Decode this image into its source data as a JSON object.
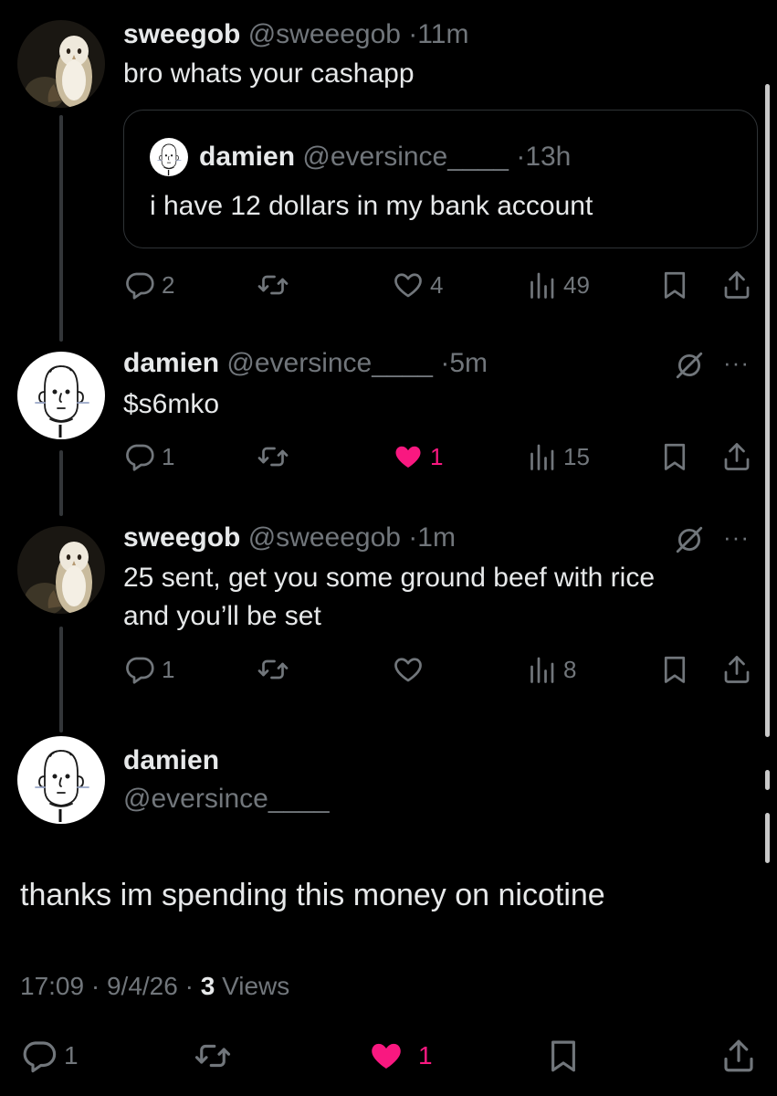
{
  "posts": [
    {
      "name": "sweegob",
      "handle": "@sweeegob",
      "dot": "·",
      "time": "11m",
      "text": "bro whats your cashapp",
      "avatar_icon": "barn-owl-avatar",
      "quote": {
        "name": "damien",
        "handle": "@eversince____",
        "dot": "·",
        "time": "13h",
        "text": "i have 12 dollars in my bank account",
        "avatar_icon": "cartoon-man-avatar"
      },
      "replies": "2",
      "reposts": "",
      "likes": "4",
      "views": "49",
      "liked": false
    },
    {
      "name": "damien",
      "handle": "@eversince____",
      "dot": "·",
      "time": "5m",
      "text": "$s6mko",
      "avatar_icon": "cartoon-man-avatar",
      "replies": "1",
      "reposts": "",
      "likes": "1",
      "views": "15",
      "liked": true,
      "more": "···"
    },
    {
      "name": "sweegob",
      "handle": "@sweeegob",
      "dot": "·",
      "time": "1m",
      "text_line1": "25 sent, get you some ground beef with rice",
      "text_line2": "and you’ll be set",
      "avatar_icon": "barn-owl-avatar",
      "replies": "1",
      "reposts": "",
      "likes": "",
      "views": "8",
      "liked": false,
      "more": "···"
    }
  ],
  "main_post": {
    "name": "damien",
    "handle": "@eversince____",
    "text": "thanks im spending this money on nicotine",
    "time": "17:09",
    "date": "9/4/26",
    "dot": "·",
    "views_count": "3",
    "views_label": "Views",
    "replies": "1",
    "likes": "1",
    "liked": true
  },
  "colors": {
    "background": "#000000",
    "text": "#e7e9ea",
    "secondary": "#71767b",
    "like_pink": "#f91880",
    "border": "#2f3336"
  },
  "icons": [
    "reply-icon",
    "repost-icon",
    "like-icon",
    "views-icon",
    "bookmark-icon",
    "share-icon",
    "grok-icon",
    "more-icon"
  ]
}
